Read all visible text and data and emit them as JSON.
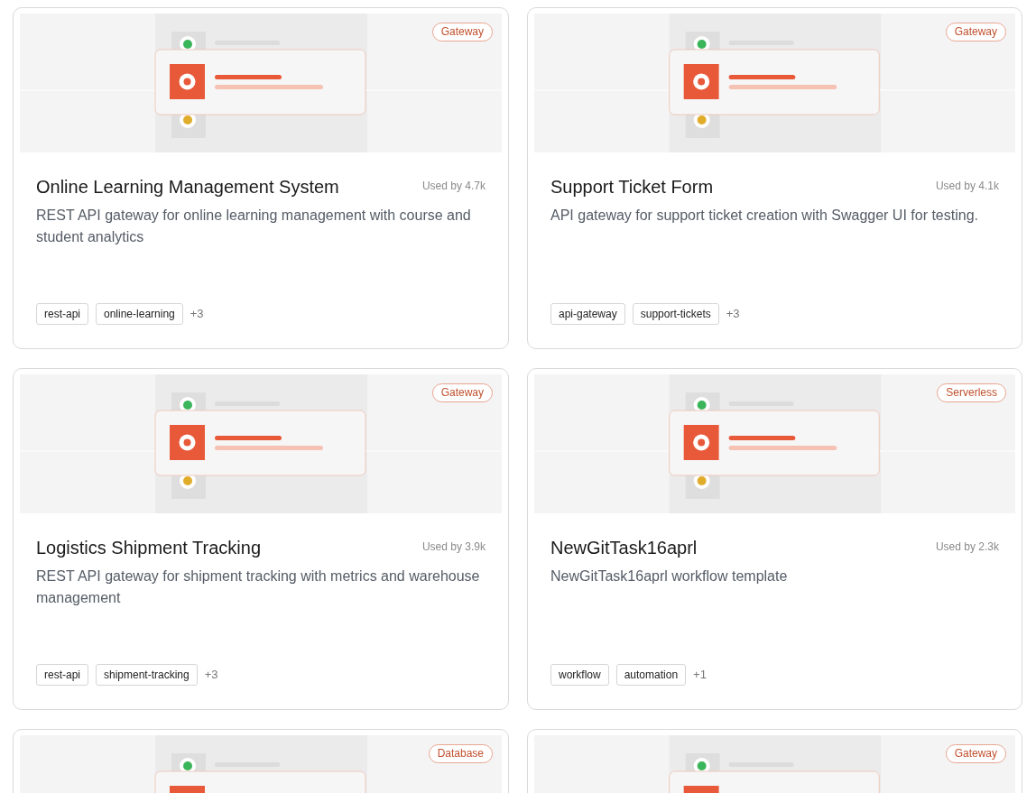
{
  "templates": [
    {
      "category": "Gateway",
      "title": "Online Learning Management System",
      "usage": "Used by 4.7k",
      "description": "REST API gateway for online learning management with course and student analytics",
      "tags": [
        "rest-api",
        "online-learning"
      ],
      "more_tags": "+3"
    },
    {
      "category": "Gateway",
      "title": "Support Ticket Form",
      "usage": "Used by 4.1k",
      "description": "API gateway for support ticket creation with Swagger UI for testing.",
      "tags": [
        "api-gateway",
        "support-tickets"
      ],
      "more_tags": "+3"
    },
    {
      "category": "Gateway",
      "title": "Logistics Shipment Tracking",
      "usage": "Used by 3.9k",
      "description": "REST API gateway for shipment tracking with metrics and warehouse management",
      "tags": [
        "rest-api",
        "shipment-tracking"
      ],
      "more_tags": "+3"
    },
    {
      "category": "Serverless",
      "title": "NewGitTask16aprl",
      "usage": "Used by 2.3k",
      "description": "NewGitTask16aprl workflow template",
      "tags": [
        "workflow",
        "automation"
      ],
      "more_tags": "+1"
    },
    {
      "category": "Database"
    },
    {
      "category": "Gateway"
    }
  ]
}
